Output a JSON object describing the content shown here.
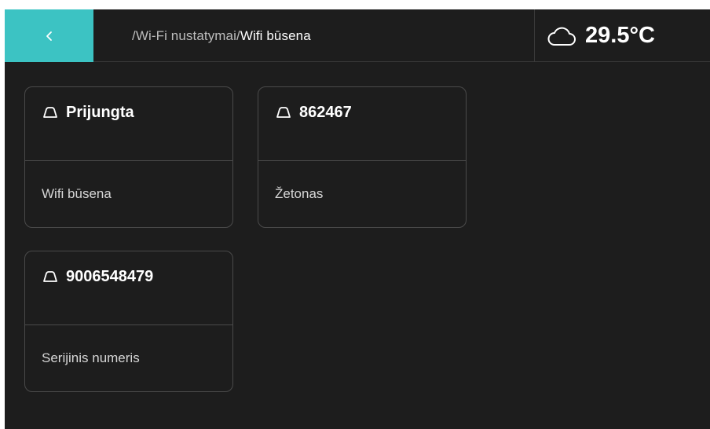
{
  "header": {
    "back_icon": "chevron-left-icon",
    "breadcrumb_parent": "/Wi-Fi nustatymai/",
    "breadcrumb_current": "Wifi būsena",
    "weather_icon": "cloud-icon",
    "temperature": "29.5°C"
  },
  "cards": [
    {
      "icon": "rounded-shape-icon",
      "value": "Prijungta",
      "label": "Wifi būsena"
    },
    {
      "icon": "rounded-shape-icon",
      "value": "862467",
      "label": "Žetonas"
    },
    {
      "icon": "rounded-shape-icon",
      "value": "9006548479",
      "label": "Serijinis numeris"
    }
  ],
  "colors": {
    "accent": "#3cc3c3",
    "background": "#1d1d1d",
    "border": "#4a4a4a"
  }
}
